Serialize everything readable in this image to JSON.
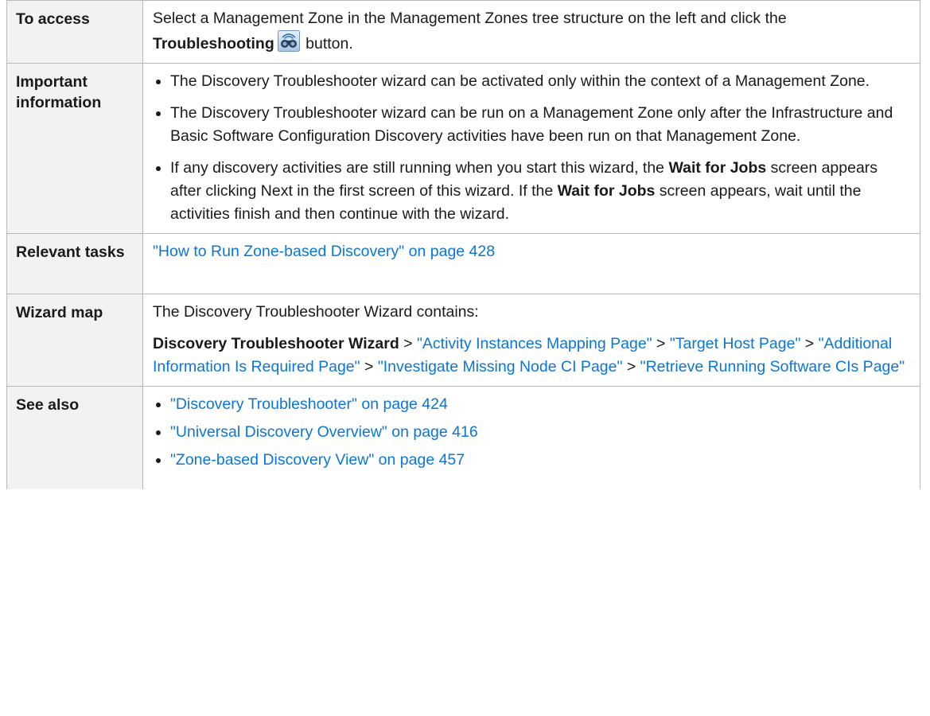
{
  "rows": {
    "access": {
      "label": "To access",
      "text_before": "Select a Management Zone in the Management Zones tree structure on the left and click the ",
      "bold": "Troubleshooting",
      "text_after": " button.",
      "icon": "troubleshooting-binoculars-icon"
    },
    "important": {
      "label": "Important information",
      "bullets": {
        "b1": {
          "text": "The Discovery Troubleshooter wizard can be activated only within the context of a Management Zone."
        },
        "b2": {
          "text": "The Discovery Troubleshooter wizard can be run on a Management Zone only after the Infrastructure and Basic Software Configuration Discovery activities have been run on that Management Zone."
        },
        "b3": {
          "t1": "If any discovery activities are still running when you start this wizard, the ",
          "bold1": "Wait for Jobs",
          "t2": " screen appears after clicking Next in the first screen of this wizard. If the ",
          "bold2": "Wait for Jobs",
          "t3": " screen appears, wait until the activities finish and then continue with the wizard."
        }
      }
    },
    "tasks": {
      "label": "Relevant tasks",
      "link": "\"How to Run Zone-based Discovery\" on page 428"
    },
    "wizard": {
      "label": "Wizard map",
      "intro": "The Discovery Troubleshooter Wizard contains:",
      "start": "Discovery Troubleshooter Wizard",
      "sep": " > ",
      "steps": [
        "\"Activity Instances Mapping Page\"",
        "\"Target Host Page\"",
        "\"Additional Information Is Required Page\"",
        "\"Investigate Missing Node CI Page\"",
        "\"Retrieve Running Software CIs Page\""
      ]
    },
    "see_also": {
      "label": "See also",
      "links": [
        "\"Discovery Troubleshooter\" on page 424",
        "\"Universal Discovery Overview\" on page 416",
        "\"Zone-based Discovery View\" on page 457"
      ]
    }
  },
  "colors": {
    "link": "#0a76d9",
    "label_bg": "#f2f2f2",
    "border": "#b8b8b8"
  }
}
